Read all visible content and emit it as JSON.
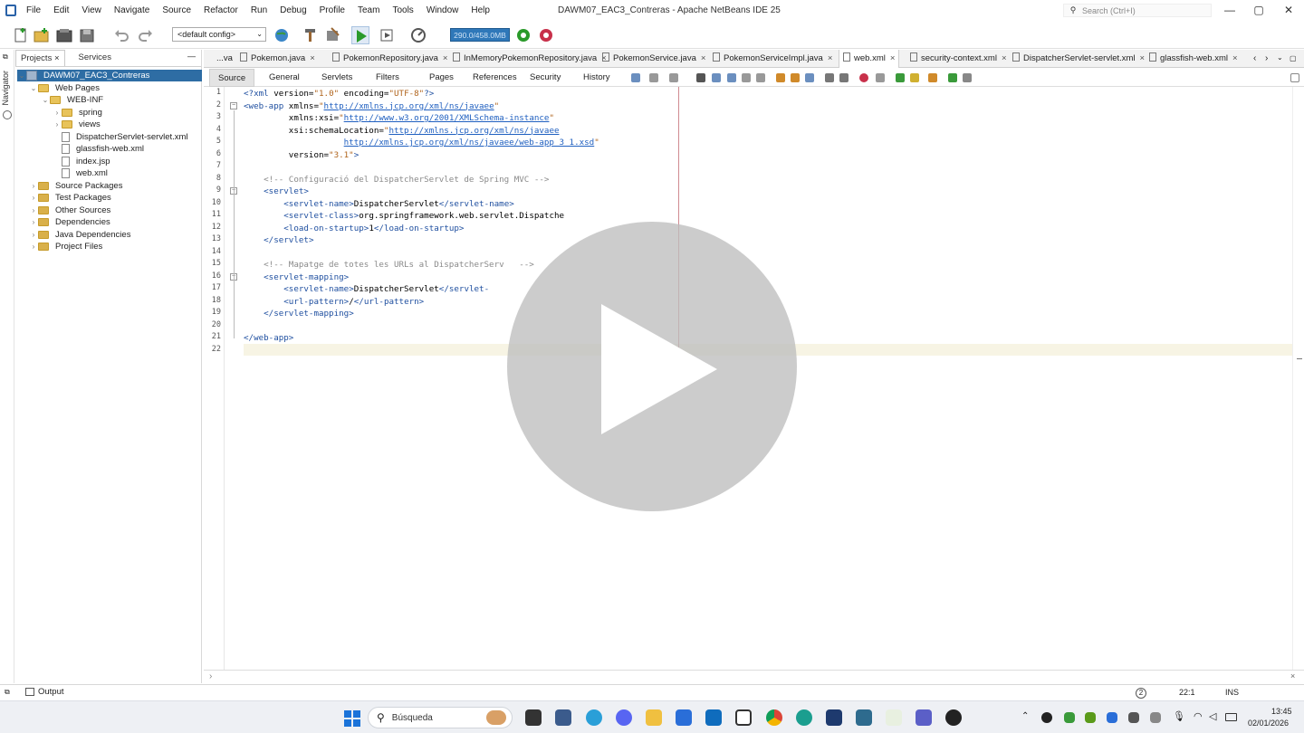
{
  "window": {
    "title": "DAWM07_EAC3_Contreras - Apache NetBeans IDE 25",
    "menu": [
      "File",
      "Edit",
      "View",
      "Navigate",
      "Source",
      "Refactor",
      "Run",
      "Debug",
      "Profile",
      "Team",
      "Tools",
      "Window",
      "Help"
    ],
    "search_placeholder": "Search (Ctrl+I)"
  },
  "toolbar": {
    "config": "<default config>",
    "memory": "290.0/458.0MB"
  },
  "side": {
    "navigator_label": "Navigator"
  },
  "projects": {
    "tabs": [
      "Projects",
      "Services"
    ],
    "tree": [
      {
        "label": "DAWM07_EAC3_Contreras",
        "level": 0,
        "icon": "project-icon",
        "expanded": true,
        "selected": true
      },
      {
        "label": "Web Pages",
        "level": 1,
        "icon": "folder-icon",
        "expanded": true
      },
      {
        "label": "WEB-INF",
        "level": 2,
        "icon": "folder-icon",
        "expanded": true
      },
      {
        "label": "spring",
        "level": 3,
        "icon": "folder-icon",
        "expanded": false
      },
      {
        "label": "views",
        "level": 3,
        "icon": "folder-icon",
        "expanded": false
      },
      {
        "label": "DispatcherServlet-servlet.xml",
        "level": 3,
        "icon": "xml-file-icon"
      },
      {
        "label": "glassfish-web.xml",
        "level": 3,
        "icon": "xml-file-icon"
      },
      {
        "label": "index.jsp",
        "level": 3,
        "icon": "jsp-file-icon"
      },
      {
        "label": "web.xml",
        "level": 3,
        "icon": "xml-file-icon"
      },
      {
        "label": "Source Packages",
        "level": 1,
        "icon": "package-folder-icon",
        "expanded": false
      },
      {
        "label": "Test Packages",
        "level": 1,
        "icon": "package-folder-icon",
        "expanded": false
      },
      {
        "label": "Other Sources",
        "level": 1,
        "icon": "package-folder-icon",
        "expanded": false
      },
      {
        "label": "Dependencies",
        "level": 1,
        "icon": "package-folder-icon",
        "expanded": false
      },
      {
        "label": "Java Dependencies",
        "level": 1,
        "icon": "package-folder-icon",
        "expanded": false
      },
      {
        "label": "Project Files",
        "level": 1,
        "icon": "package-folder-icon",
        "expanded": false
      }
    ]
  },
  "editor_tabs": [
    {
      "label": "...va",
      "close": "×"
    },
    {
      "label": "Pokemon.java",
      "close": "×"
    },
    {
      "label": "PokemonRepository.java",
      "close": "×"
    },
    {
      "label": "InMemoryPokemonRepository.java",
      "close": "×"
    },
    {
      "label": "PokemonService.java",
      "close": "×"
    },
    {
      "label": "PokemonServiceImpl.java",
      "close": "×"
    },
    {
      "label": "web.xml",
      "close": "×",
      "active": true
    },
    {
      "label": "security-context.xml",
      "close": "×"
    },
    {
      "label": "DispatcherServlet-servlet.xml",
      "close": "×"
    },
    {
      "label": "glassfish-web.xml",
      "close": "×"
    }
  ],
  "view_tabs": [
    "Source",
    "General",
    "Servlets",
    "Filters",
    "Pages",
    "References",
    "Security",
    "History"
  ],
  "code_lines": [
    "<?xml version=\"1.0\" encoding=\"UTF-8\"?>",
    "<web-app xmlns=\"http://xmlns.jcp.org/xml/ns/javaee\"",
    "         xmlns:xsi=\"http://www.w3.org/2001/XMLSchema-instance\"",
    "         xsi:schemaLocation=\"http://xmlns.jcp.org/xml/ns/javaee",
    "                    http://xmlns.jcp.org/xml/ns/javaee/web-app_3_1.xsd\"",
    "         version=\"3.1\">",
    "",
    "    <!-- Configuració del DispatcherServlet de Spring MVC -->",
    "    <servlet>",
    "        <servlet-name>DispatcherServlet</servlet-name>",
    "        <servlet-class>org.springframework.web.servlet.Dispatche",
    "        <load-on-startup>1</load-on-startup>",
    "    </servlet>",
    "",
    "    <!-- Mapatge de totes les URLs al DispatcherServ   -->",
    "    <servlet-mapping>",
    "        <servlet-name>DispatcherServlet</servlet-",
    "        <url-pattern>/</url-pattern>",
    "    </servlet-mapping>",
    "",
    "</web-app>",
    ""
  ],
  "statusbar": {
    "position": "22:1",
    "mode": "INS",
    "notif_count": "2"
  },
  "output": {
    "label": "Output"
  },
  "taskbar": {
    "search_label": "Búsqueda",
    "time": "13:45",
    "date": "02/01/2026"
  },
  "colors": {
    "selection": "#2e6da4",
    "xml_tag": "#2050a0",
    "xml_value": "#b0641c",
    "comment": "#8a8a8a",
    "memory_bar": "#2f78b9"
  }
}
